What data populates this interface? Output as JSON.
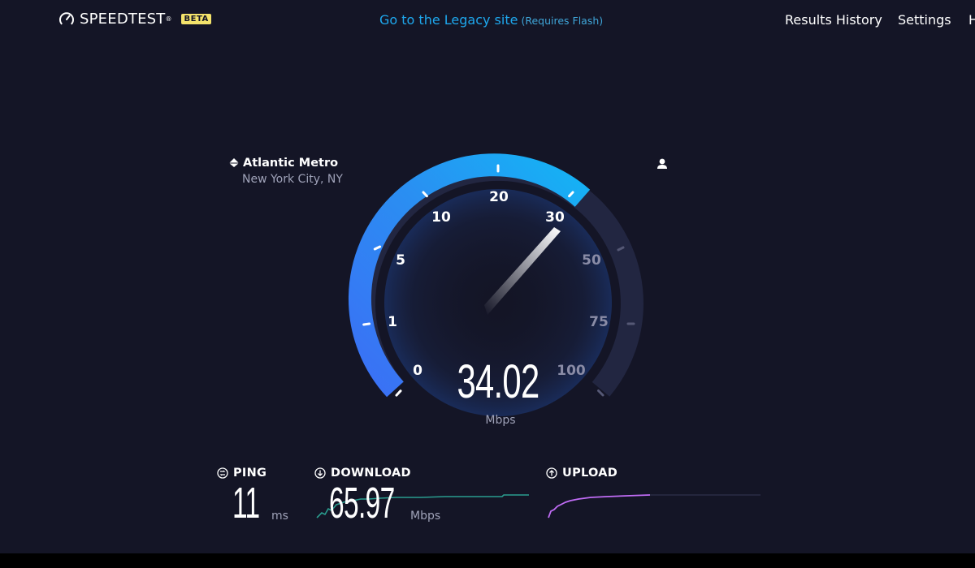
{
  "header": {
    "logo_text": "SPEEDTEST",
    "trademark": "®",
    "beta_badge": "BETA",
    "legacy_link": "Go to the Legacy site",
    "legacy_note": "(Requires Flash)",
    "nav": {
      "results_history": "Results History",
      "settings": "Settings",
      "help": "H"
    }
  },
  "server": {
    "isp_name": "Atlantic Metro",
    "location": "New York City, NY"
  },
  "gauge": {
    "scale_labels": [
      "0",
      "1",
      "5",
      "10",
      "20",
      "30",
      "50",
      "75",
      "100"
    ],
    "current_speed": "34.02",
    "unit": "Mbps",
    "fill_color": "#1d9bf0",
    "track_color": "#222641"
  },
  "results": {
    "ping": {
      "label": "PING",
      "value": "11",
      "unit": "ms"
    },
    "download": {
      "label": "DOWNLOAD",
      "value": "65.97",
      "unit": "Mbps",
      "color": "#2dd4bf"
    },
    "upload": {
      "label": "UPLOAD",
      "color": "#c06cf5"
    }
  }
}
